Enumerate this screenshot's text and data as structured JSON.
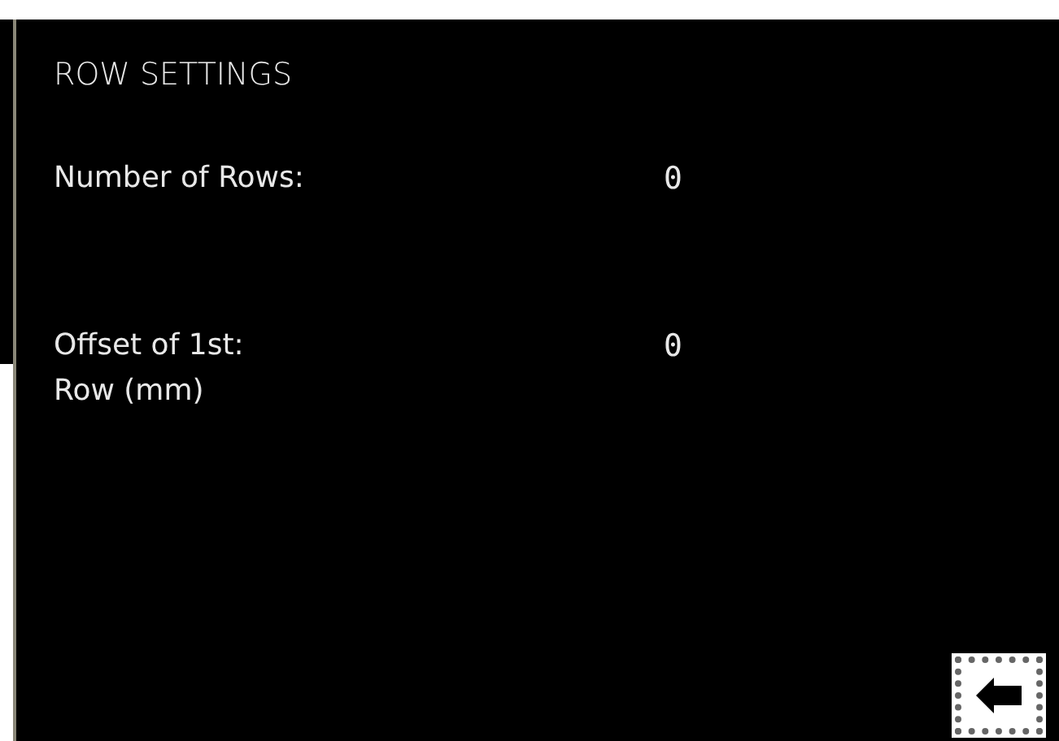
{
  "title": "ROW SETTINGS",
  "settings": [
    {
      "label": "Number of Rows:",
      "value": "0"
    },
    {
      "label": "Offset of 1st:\nRow (mm)",
      "value": "0"
    }
  ]
}
